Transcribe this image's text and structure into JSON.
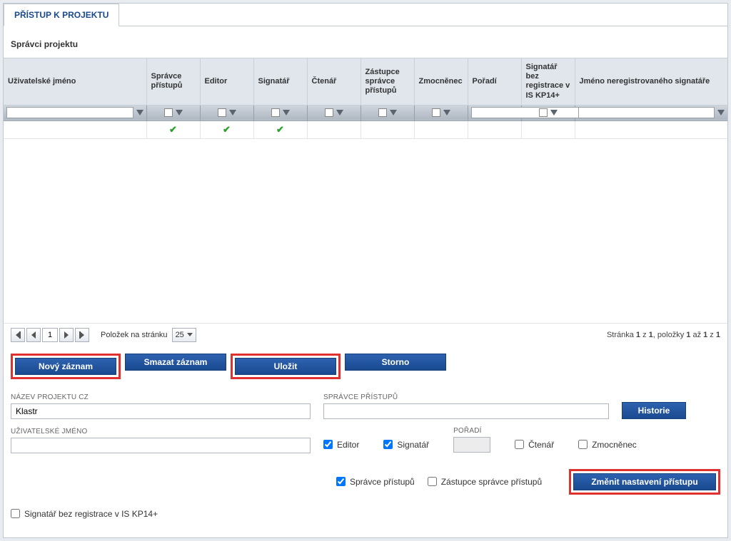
{
  "tab": {
    "label": "PŘÍSTUP K PROJEKTU"
  },
  "section": {
    "title": "Správci projektu"
  },
  "headers": {
    "user": "Uživatelské jméno",
    "spravce": "Správce přístupů",
    "editor": "Editor",
    "signatar": "Signatář",
    "ctenar": "Čtenář",
    "zastupce": "Zástupce správce přístupů",
    "zmocnenec": "Zmocněnec",
    "poradi": "Pořadí",
    "signobez": "Signatář bez registrace v IS KP14+",
    "neregname": "Jméno neregistrovaného signatáře"
  },
  "pager": {
    "page": "1",
    "items_label": "Položek na stránku",
    "page_size": "25",
    "info_prefix": "Stránka ",
    "info_p1": "1",
    "info_z": " z ",
    "info_pt": "1",
    "info_items": ", položky ",
    "info_i1": "1",
    "info_az": " až ",
    "info_i2": "1",
    "info_z2": " z ",
    "info_it": "1"
  },
  "buttons": {
    "novy": "Nový záznam",
    "smazat": "Smazat záznam",
    "ulozit": "Uložit",
    "storno": "Storno",
    "historie": "Historie",
    "zmenit": "Změnit nastavení přístupu"
  },
  "form": {
    "nazev_label": "NÁZEV PROJEKTU CZ",
    "nazev_value": "Klastr",
    "spravce_label": "SPRÁVCE PŘÍSTUPŮ",
    "spravce_value": "",
    "uzivjm_label": "UŽIVATELSKÉ JMÉNO",
    "uzivjm_value": "",
    "poradi_label": "POŘADÍ",
    "poradi_value": "",
    "editor_cb": "Editor",
    "signatar_cb": "Signatář",
    "ctenar_cb": "Čtenář",
    "zmocnenec_cb": "Zmocněnec",
    "spravce_cb": "Správce přístupů",
    "zastupce_cb": "Zástupce správce přístupů",
    "signobez_cb": "Signatář bez registrace v IS KP14+"
  }
}
